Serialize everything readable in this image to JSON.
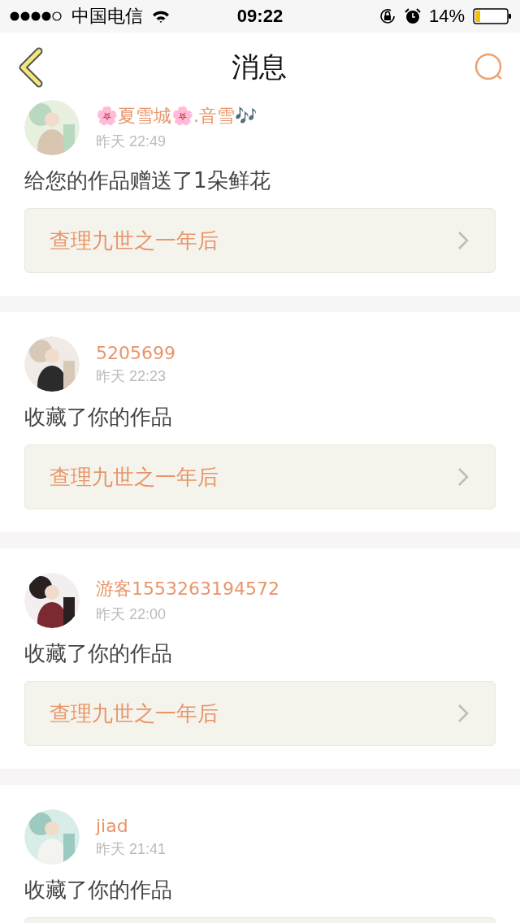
{
  "status_bar": {
    "carrier": "中国电信",
    "time": "09:22",
    "battery": "14%"
  },
  "nav": {
    "title": "消息"
  },
  "messages": [
    {
      "name": "🌸夏雪城🌸.音雪🎶",
      "time": "昨天 22:49",
      "action": "给您的作品赠送了1朵鲜花",
      "work": "查理九世之一年后"
    },
    {
      "name": "5205699",
      "time": "昨天 22:23",
      "action": "收藏了你的作品",
      "work": "查理九世之一年后"
    },
    {
      "name": "游客1553263194572",
      "time": "昨天 22:00",
      "action": "收藏了你的作品",
      "work": "查理九世之一年后"
    },
    {
      "name": "jiad",
      "time": "昨天 21:41",
      "action": "收藏了你的作品"
    }
  ]
}
